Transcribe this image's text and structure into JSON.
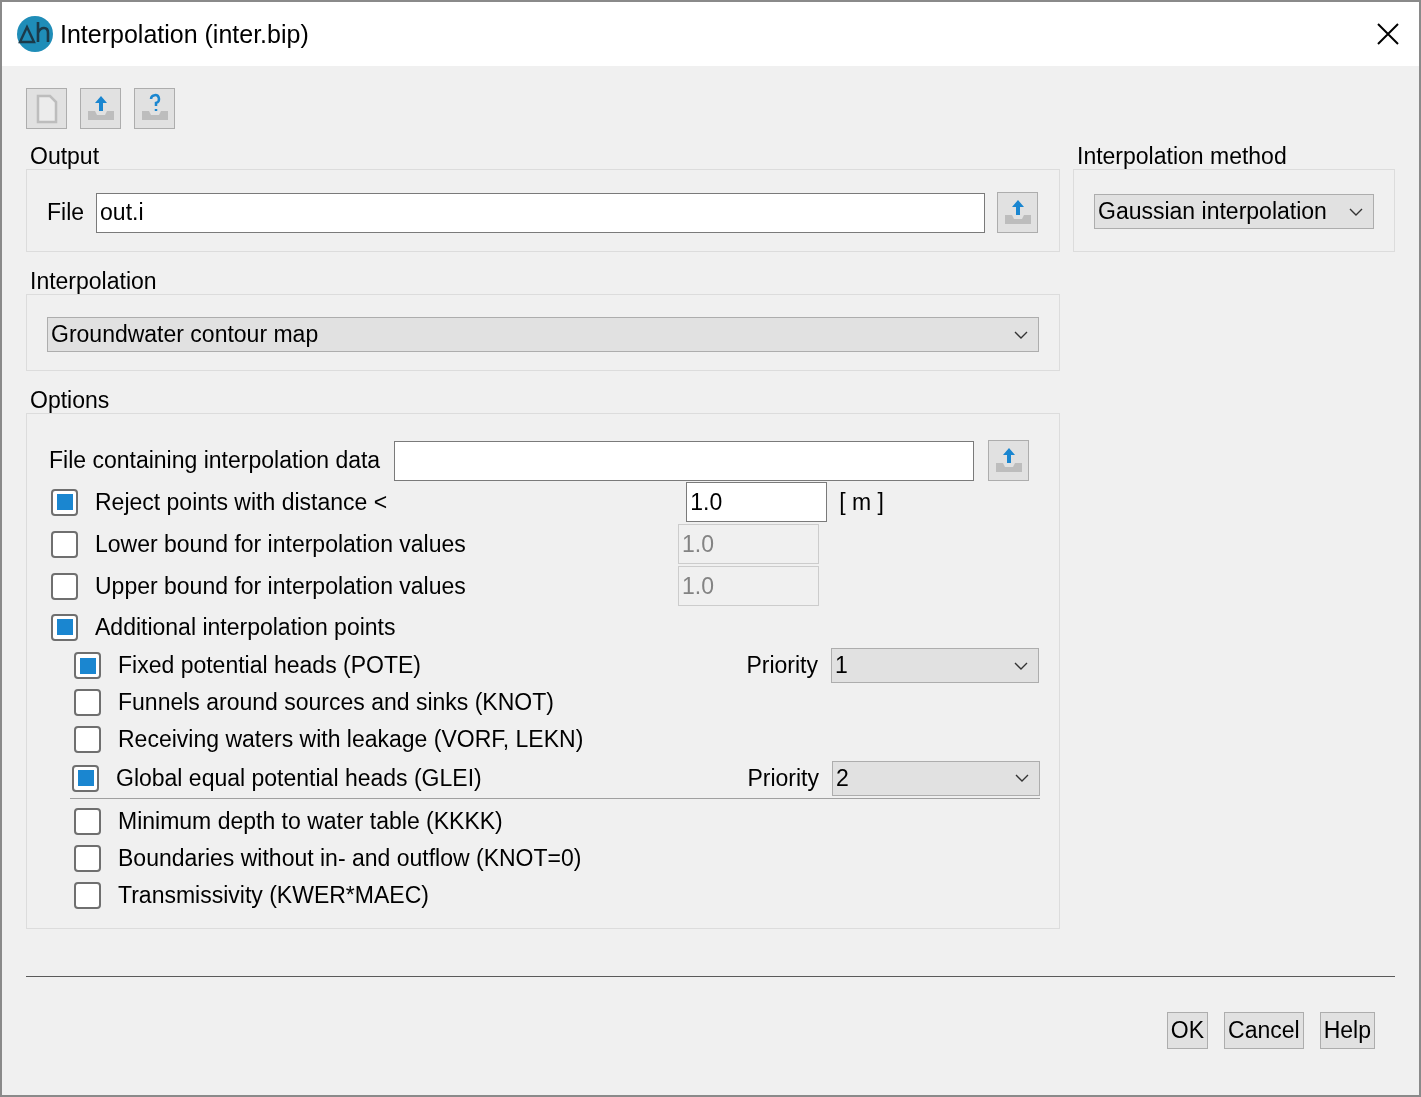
{
  "window": {
    "title": "Interpolation (inter.bip)"
  },
  "output": {
    "title": "Output",
    "file_label": "File",
    "file_value": "out.i"
  },
  "interpolation_method": {
    "title": "Interpolation method",
    "value": "Gaussian interpolation"
  },
  "interpolation": {
    "title": "Interpolation",
    "value": "Groundwater contour map"
  },
  "options": {
    "title": "Options",
    "data_file_label": "File containing interpolation data",
    "items": [
      {
        "kind": "value",
        "label": "Reject points with distance <",
        "checked": true,
        "value": "1.0",
        "disabled": false,
        "unit": "[ m ]"
      },
      {
        "kind": "value",
        "label": "Lower bound for interpolation values",
        "checked": false,
        "value": "1.0",
        "disabled": true
      },
      {
        "kind": "value",
        "label": "Upper bound for interpolation values",
        "checked": false,
        "value": "1.0",
        "disabled": true
      },
      {
        "kind": "group",
        "label": "Additional interpolation points",
        "checked": true,
        "children": [
          {
            "label": "Fixed potential heads (POTE)",
            "checked": true,
            "priority_label": "Priority",
            "priority": "1",
            "separator_below": false
          },
          {
            "label": "Funnels around sources and sinks (KNOT)",
            "checked": false,
            "separator_below": false
          },
          {
            "label": "Receiving waters with leakage (VORF, LEKN)",
            "checked": false,
            "separator_below": false
          },
          {
            "label": "Global equal potential heads (GLEI)",
            "checked": true,
            "priority_label": "Priority",
            "priority": "2",
            "separator_below": true
          },
          {
            "label": "Minimum depth to water table (KKKK)",
            "checked": false,
            "separator_below": false
          },
          {
            "label": "Boundaries without in- and outflow (KNOT=0)",
            "checked": false,
            "separator_below": false
          },
          {
            "label": "Transmissivity (KWER*MAEC)",
            "checked": false,
            "separator_below": false
          }
        ]
      }
    ]
  },
  "buttons": [
    "OK",
    "Cancel",
    "Help"
  ]
}
